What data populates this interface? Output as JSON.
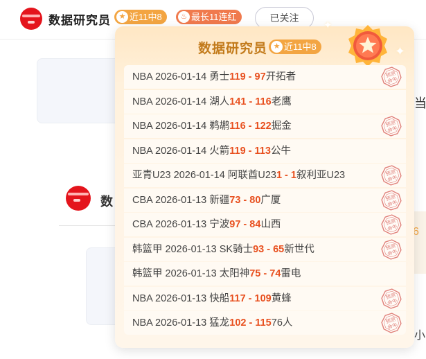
{
  "header": {
    "expert_name": "数据研究员",
    "recent_badge": "近11中8",
    "streak_badge": "最长11连红",
    "follow_label": "已关注"
  },
  "background": {
    "name_fragment": "数",
    "edge_char": "当",
    "edge_number": "6",
    "edge_char2": "小"
  },
  "popover": {
    "title": "数据研究员",
    "recent_badge": "近11中8",
    "stamp_text": "预测命中"
  },
  "records": [
    {
      "league": "NBA",
      "date": "2026-01-14",
      "home": "勇士",
      "home_score": "119",
      "away_score": "97",
      "away": "开拓者",
      "hit": true
    },
    {
      "league": "NBA",
      "date": "2026-01-14",
      "home": "湖人",
      "home_score": "141",
      "away_score": "116",
      "away": "老鹰",
      "hit": false
    },
    {
      "league": "NBA",
      "date": "2026-01-14",
      "home": "鹈鹕",
      "home_score": "116",
      "away_score": "122",
      "away": "掘金",
      "hit": true
    },
    {
      "league": "NBA",
      "date": "2026-01-14",
      "home": "火箭",
      "home_score": "119",
      "away_score": "113",
      "away": "公牛",
      "hit": false
    },
    {
      "league": "亚青U23",
      "date": "2026-01-14",
      "home": "阿联酋U23",
      "home_score": "1",
      "away_score": "1",
      "away": "叙利亚U23",
      "hit": true
    },
    {
      "league": "CBA",
      "date": "2026-01-13",
      "home": "新疆",
      "home_score": "73",
      "away_score": "80",
      "away": "广厦",
      "hit": true
    },
    {
      "league": "CBA",
      "date": "2026-01-13",
      "home": "宁波",
      "home_score": "97",
      "away_score": "84",
      "away": "山西",
      "hit": true
    },
    {
      "league": "韩篮甲",
      "date": "2026-01-13",
      "home": "SK骑士",
      "home_score": "93",
      "away_score": "65",
      "away": "新世代",
      "hit": true
    },
    {
      "league": "韩篮甲",
      "date": "2026-01-13",
      "home": "太阳神",
      "home_score": "75",
      "away_score": "74",
      "away": "雷电",
      "hit": false
    },
    {
      "league": "NBA",
      "date": "2026-01-13",
      "home": "快船",
      "home_score": "117",
      "away_score": "109",
      "away": "黄蜂",
      "hit": true
    },
    {
      "league": "NBA",
      "date": "2026-01-13",
      "home": "猛龙",
      "home_score": "102",
      "away_score": "115",
      "away": "76人",
      "hit": true
    }
  ],
  "colors": {
    "accent": "#e8501f",
    "badge": "#f3a542",
    "streak": "#f07a4d",
    "stamp": "#e0807a",
    "avatar": "#e4141c"
  },
  "icons": {
    "badge_icon": "star-icon",
    "streak_icon": "flame-icon",
    "medal_icon": "medal-star-icon"
  }
}
